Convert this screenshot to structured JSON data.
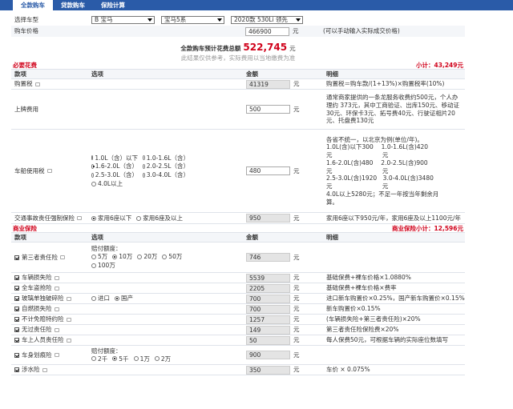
{
  "tabs": [
    {
      "label": "全款购车",
      "active": true
    },
    {
      "label": "贷款购车",
      "active": false
    },
    {
      "label": "保险计算",
      "active": false
    }
  ],
  "car": {
    "label": "选择车型",
    "brand": "B 宝马",
    "series": "宝马5系",
    "model": "2020款 530Li 领先"
  },
  "price": {
    "label": "购车价格",
    "value": "466900",
    "unit": "元",
    "hint": "(可以手动输入实际成交价格)"
  },
  "total": {
    "label": "全款购车预计花费总额",
    "value": "522,745",
    "unit": "元",
    "disclaimer": "此结果仅供参考，实际费用以当地缴费为准"
  },
  "required": {
    "title": "必要花费",
    "subtotal_label": "小计：",
    "subtotal": "43,249元",
    "headers": [
      "款项",
      "选项",
      "金额",
      "明细"
    ],
    "purchase_tax": {
      "name": "购置税",
      "amount": "41319",
      "unit": "元",
      "detail": "购置税＝购车款/(1+13%)×购置税率(10%)"
    },
    "plate": {
      "name": "上牌费用",
      "amount": "500",
      "unit": "元",
      "detail": "通常商家提供的一条龙服务收费约500元，个人办理约 373元，其中工商验证、出库150元、移动证30元、环保卡3元、拓号费40元、行驶证相片20元、托盘费130元"
    },
    "vehicle_tax": {
      "name": "车船使用税",
      "options": [
        "1.0L（含）以下",
        "1.0-1.6L（含）",
        "1.6-2.0L（含）",
        "2.0-2.5L（含）",
        "2.5-3.0L（含）",
        "3.0-4.0L（含）",
        "4.0L以上"
      ],
      "selected": 2,
      "amount": "480",
      "unit": "元",
      "detail_lines": [
        "各省不统一，以北京为例(单位/年)。",
        "1.0L(含)以下300　 1.0-1.6L(含)420",
        "元　　　　　　　　 元",
        "1.6-2.0L(含)480　 2.0-2.5L(含)900",
        "元　　　　　　　　 元",
        "2.5-3.0L(含)1920　3.0-4.0L(含)3480",
        "元　　　　　　　　 元",
        "4.0L以上5280元；不足一年按当年剩余月",
        "算。"
      ]
    },
    "compulsory": {
      "name": "交通事故责任强制保险",
      "options": [
        "家用6座以下",
        "家用6座及以上"
      ],
      "selected": 0,
      "amount": "950",
      "unit": "元",
      "detail": "家用6座以下950元/年，家用6座及以上1100元/年"
    }
  },
  "commercial": {
    "title": "商业保险",
    "subtotal_label": "商业保险小计：",
    "subtotal": "12,596元",
    "headers": [
      "款项",
      "选项",
      "金额",
      "明细"
    ],
    "items": [
      {
        "name": "第三者责任险",
        "checked": true,
        "option_title": "赔付额度：",
        "options": [
          "5万",
          "10万",
          "20万",
          "50万",
          "100万"
        ],
        "selected": 1,
        "amount": "746",
        "unit": "元",
        "detail": ""
      },
      {
        "name": "车辆损失险",
        "checked": true,
        "amount": "5539",
        "unit": "元",
        "detail": "基础保费+裸车价格×1.0880%"
      },
      {
        "name": "全车盗抢险",
        "checked": true,
        "amount": "2205",
        "unit": "元",
        "detail": "基础保费+裸车价格×费率"
      },
      {
        "name": "玻璃单独破碎险",
        "checked": true,
        "options": [
          "进口",
          "国产"
        ],
        "selected": 1,
        "amount": "700",
        "unit": "元",
        "detail": "进口新车购置价×0.25%，国产新车购置价×0.15%"
      },
      {
        "name": "自燃损失险",
        "checked": true,
        "amount": "700",
        "unit": "元",
        "detail": "新车购置价×0.15%"
      },
      {
        "name": "不计免赔特约险",
        "checked": true,
        "amount": "1257",
        "unit": "元",
        "detail": "(车辆损失险+第三者责任险)×20%"
      },
      {
        "name": "无过责任险",
        "checked": true,
        "amount": "149",
        "unit": "元",
        "detail": "第三者责任险保险费×20%"
      },
      {
        "name": "车上人员责任险",
        "checked": true,
        "amount": "50",
        "unit": "元",
        "detail": "每人保费50元，可根据车辆的实际座位数填写"
      },
      {
        "name": "车身划痕险",
        "checked": true,
        "option_title": "赔付额度：",
        "options": [
          "2千",
          "5千",
          "1万",
          "2万"
        ],
        "selected": 1,
        "amount": "900",
        "unit": "元",
        "detail": ""
      },
      {
        "name": "涉水险",
        "checked": true,
        "amount": "350",
        "unit": "元",
        "detail": "车价 × 0.075%"
      }
    ]
  }
}
